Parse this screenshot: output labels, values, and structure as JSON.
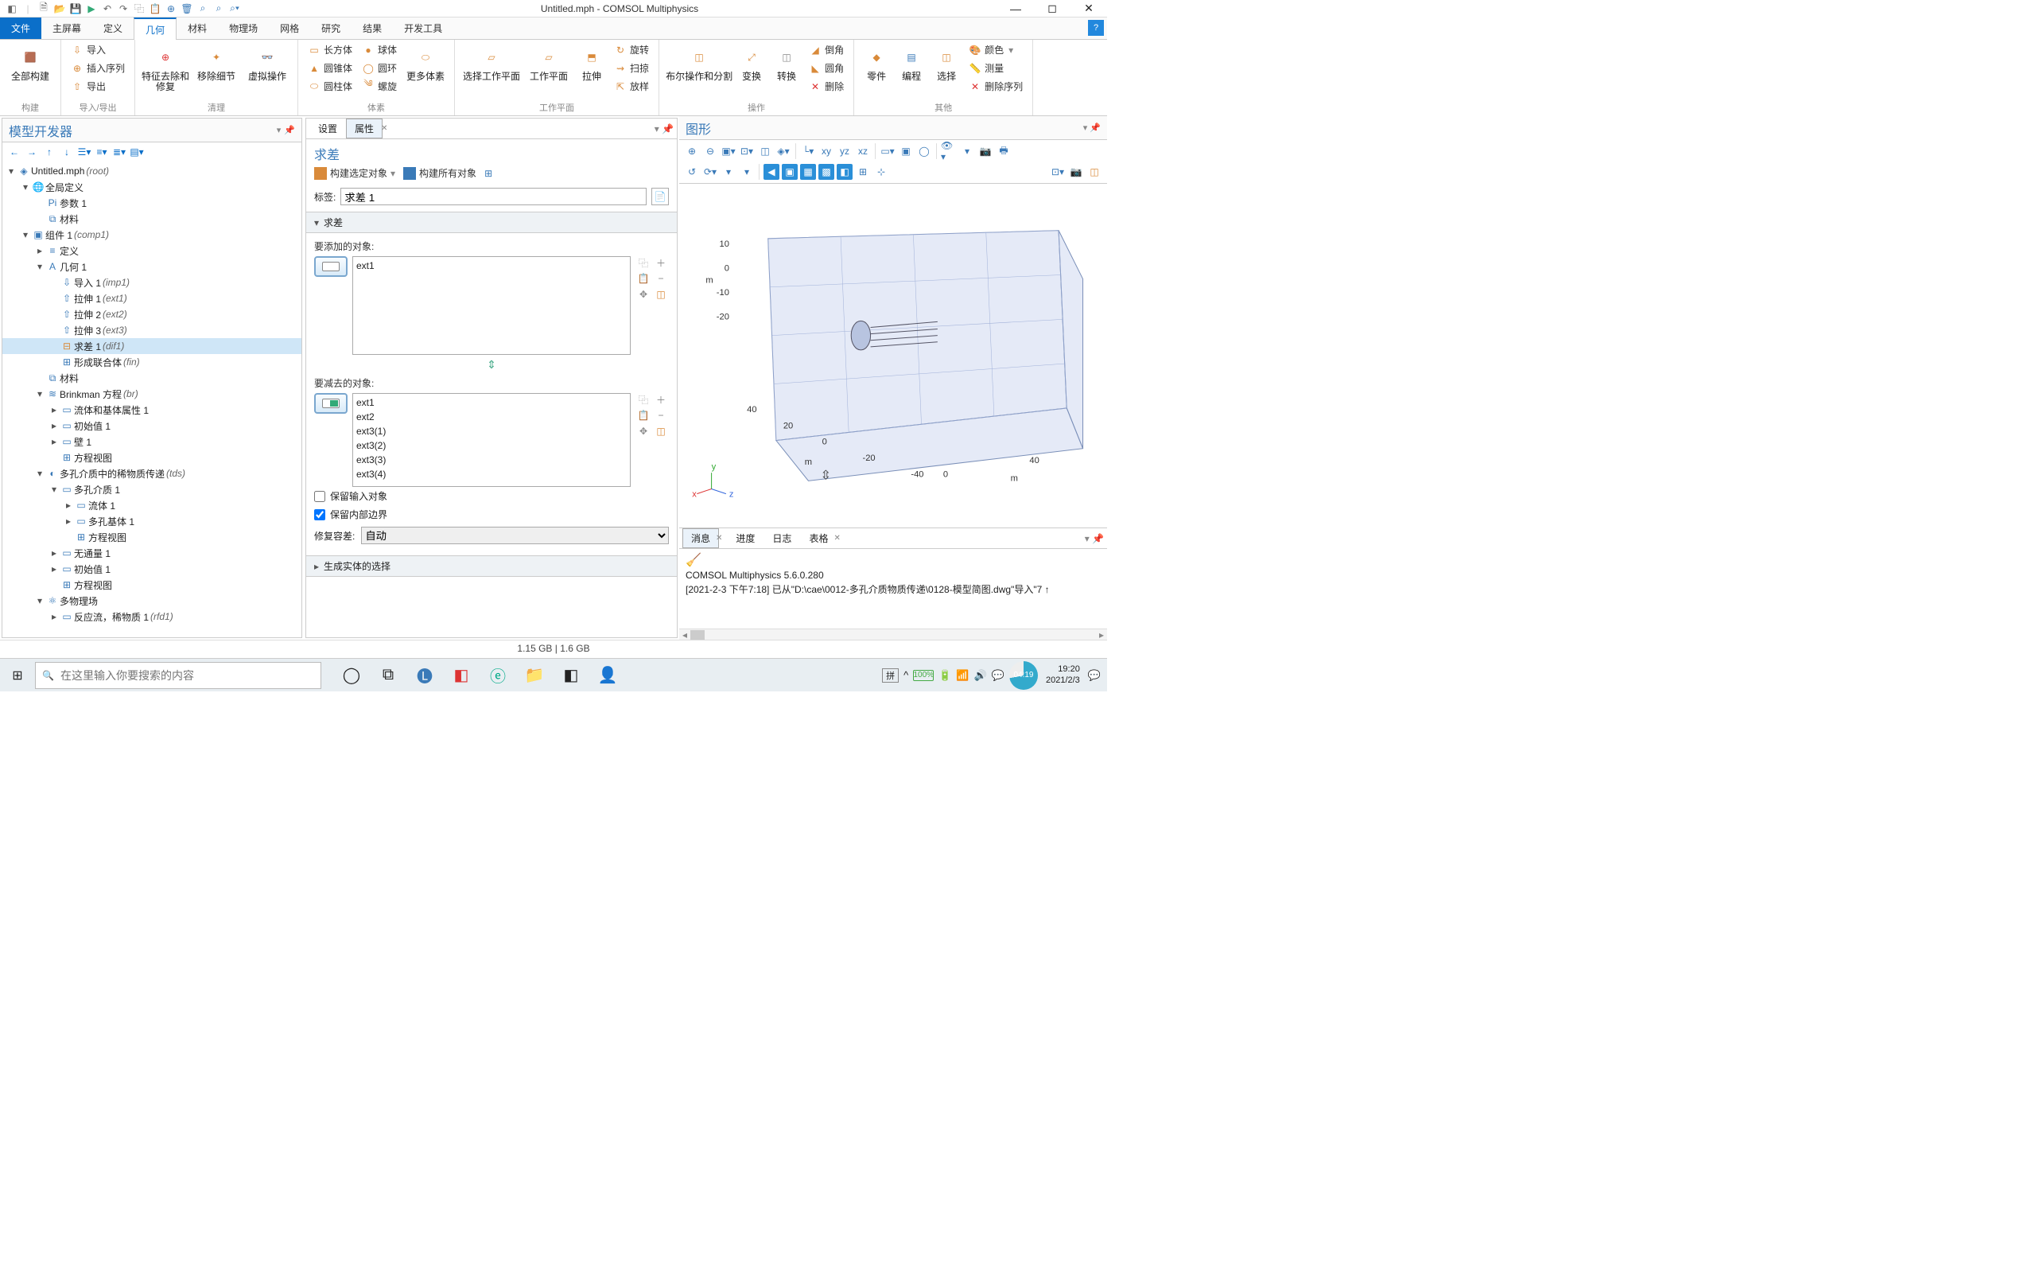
{
  "titlebar": {
    "title": "Untitled.mph - COMSOL Multiphysics"
  },
  "menubar": {
    "file": "文件",
    "tabs": [
      "主屏幕",
      "定义",
      "几何",
      "材料",
      "物理场",
      "网格",
      "研究",
      "结果",
      "开发工具"
    ],
    "active": "几何"
  },
  "ribbon": {
    "groups": {
      "build": {
        "all_build": "全部构建",
        "label": "构建"
      },
      "io": {
        "import": "导入",
        "insert_seq": "插入序列",
        "export": "导出",
        "label": "导入/导出"
      },
      "cleanup": {
        "virtual_op": "虚拟操作",
        "remove_detail": "移除细节",
        "defeature": "特征去除和修复",
        "label": "清理"
      },
      "primitives": {
        "box": "长方体",
        "sphere": "球体",
        "cone": "圆锥体",
        "torus": "圆环",
        "cylinder": "圆柱体",
        "helix": "螺旋",
        "more": "更多体素",
        "label": "体素"
      },
      "workplane": {
        "select_wp": "选择工作平面",
        "wp": "工作平面",
        "extrude": "拉伸",
        "rotate": "旋转",
        "sweep": "扫掠",
        "loft": "放样",
        "label": "工作平面"
      },
      "ops": {
        "boolean": "布尔操作和分割",
        "transform": "变换",
        "convert": "转换",
        "fillet": "倒角",
        "chamfer": "圆角",
        "delete": "删除",
        "label": "操作"
      },
      "other": {
        "parts": "零件",
        "program": "编程",
        "select": "选择",
        "color": "颜色",
        "measure": "测量",
        "del_seq": "删除序列",
        "label": "其他"
      }
    }
  },
  "tree": {
    "title": "模型开发器",
    "rows": [
      {
        "d": 0,
        "caret": "▾",
        "ic": "◈",
        "text": "Untitled.mph",
        "it": "(root)"
      },
      {
        "d": 1,
        "caret": "▾",
        "ic": "🌐",
        "text": "全局定义"
      },
      {
        "d": 2,
        "caret": "",
        "ic": "Pi",
        "text": "参数 1"
      },
      {
        "d": 2,
        "caret": "",
        "ic": "⧉",
        "text": "材料"
      },
      {
        "d": 1,
        "caret": "▾",
        "ic": "▣",
        "text": "组件 1",
        "it": "(comp1)"
      },
      {
        "d": 2,
        "caret": "▸",
        "ic": "≡",
        "text": "定义"
      },
      {
        "d": 2,
        "caret": "▾",
        "ic": "A",
        "text": "几何 1"
      },
      {
        "d": 3,
        "caret": "",
        "ic": "⇩",
        "text": "导入 1",
        "it": "(imp1)"
      },
      {
        "d": 3,
        "caret": "",
        "ic": "⇧",
        "text": "拉伸 1",
        "it": "(ext1)"
      },
      {
        "d": 3,
        "caret": "",
        "ic": "⇧",
        "text": "拉伸 2",
        "it": "(ext2)"
      },
      {
        "d": 3,
        "caret": "",
        "ic": "⇧",
        "text": "拉伸 3",
        "it": "(ext3)"
      },
      {
        "d": 3,
        "caret": "",
        "ic": "⊟",
        "text": "求差 1",
        "it": "(dif1)",
        "sel": true
      },
      {
        "d": 3,
        "caret": "",
        "ic": "⊞",
        "text": "形成联合体",
        "it": "(fin)"
      },
      {
        "d": 2,
        "caret": "",
        "ic": "⧉",
        "text": "材料"
      },
      {
        "d": 2,
        "caret": "▾",
        "ic": "≋",
        "text": "Brinkman 方程",
        "it": "(br)"
      },
      {
        "d": 3,
        "caret": "▸",
        "ic": "▭",
        "text": "流体和基体属性 1"
      },
      {
        "d": 3,
        "caret": "▸",
        "ic": "▭",
        "text": "初始值 1"
      },
      {
        "d": 3,
        "caret": "▸",
        "ic": "▭",
        "text": "壁 1"
      },
      {
        "d": 3,
        "caret": "",
        "ic": "⊞",
        "text": "方程视图"
      },
      {
        "d": 2,
        "caret": "▾",
        "ic": "◐",
        "text": "多孔介质中的稀物质传递",
        "it": "(tds)"
      },
      {
        "d": 3,
        "caret": "▾",
        "ic": "▭",
        "text": "多孔介质 1"
      },
      {
        "d": 4,
        "caret": "▸",
        "ic": "▭",
        "text": "流体 1"
      },
      {
        "d": 4,
        "caret": "▸",
        "ic": "▭",
        "text": "多孔基体 1"
      },
      {
        "d": 4,
        "caret": "",
        "ic": "⊞",
        "text": "方程视图"
      },
      {
        "d": 3,
        "caret": "▸",
        "ic": "▭",
        "text": "无通量 1"
      },
      {
        "d": 3,
        "caret": "▸",
        "ic": "▭",
        "text": "初始值 1"
      },
      {
        "d": 3,
        "caret": "",
        "ic": "⊞",
        "text": "方程视图"
      },
      {
        "d": 2,
        "caret": "▾",
        "ic": "⚛",
        "text": "多物理场"
      },
      {
        "d": 3,
        "caret": "▸",
        "ic": "▭",
        "text": "反应流，稀物质 1",
        "it": "(rfd1)"
      }
    ]
  },
  "settings": {
    "tabs": {
      "settings": "设置",
      "props": "属性"
    },
    "title": "求差",
    "actions": {
      "build_selected": "构建选定对象",
      "build_all": "构建所有对象"
    },
    "label_label": "标签:",
    "label_value": "求差 1",
    "sections": {
      "difference": "求差",
      "generated": "生成实体的选择"
    },
    "add_label": "要添加的对象:",
    "add_items": [
      "ext1"
    ],
    "subtract_label": "要减去的对象:",
    "subtract_items": [
      "ext1",
      "ext2",
      "ext3(1)",
      "ext3(2)",
      "ext3(3)",
      "ext3(4)"
    ],
    "keep_input": "保留输入对象",
    "keep_interior": "保留内部边界",
    "repair_label": "修复容差:",
    "repair_value": "自动"
  },
  "graphics": {
    "title": "图形",
    "axis_labels": {
      "x": "x",
      "y": "y",
      "z": "z",
      "unit": "m"
    },
    "ticks_y": [
      "10",
      "0",
      "-10",
      "-20"
    ],
    "ticks_x1": [
      "40",
      "20",
      "0",
      "-20",
      "-40"
    ],
    "ticks_x2": [
      "0",
      "40"
    ]
  },
  "messages": {
    "tabs": [
      "消息",
      "进度",
      "日志",
      "表格"
    ],
    "lines": [
      "COMSOL Multiphysics 5.6.0.280",
      "[2021-2-3 下午7:18] 已从\"D:\\cae\\0012-多孔介质物质传递\\0128-模型简图.dwg\"导入\"7 ↑"
    ]
  },
  "statusbar": {
    "text": "1.15 GB | 1.6 GB"
  },
  "taskbar": {
    "search_placeholder": "在这里输入你要搜索的内容",
    "ime": "拼",
    "battery": "100%",
    "time_ind": "04:19",
    "time": "19:20",
    "date": "2021/2/3"
  }
}
